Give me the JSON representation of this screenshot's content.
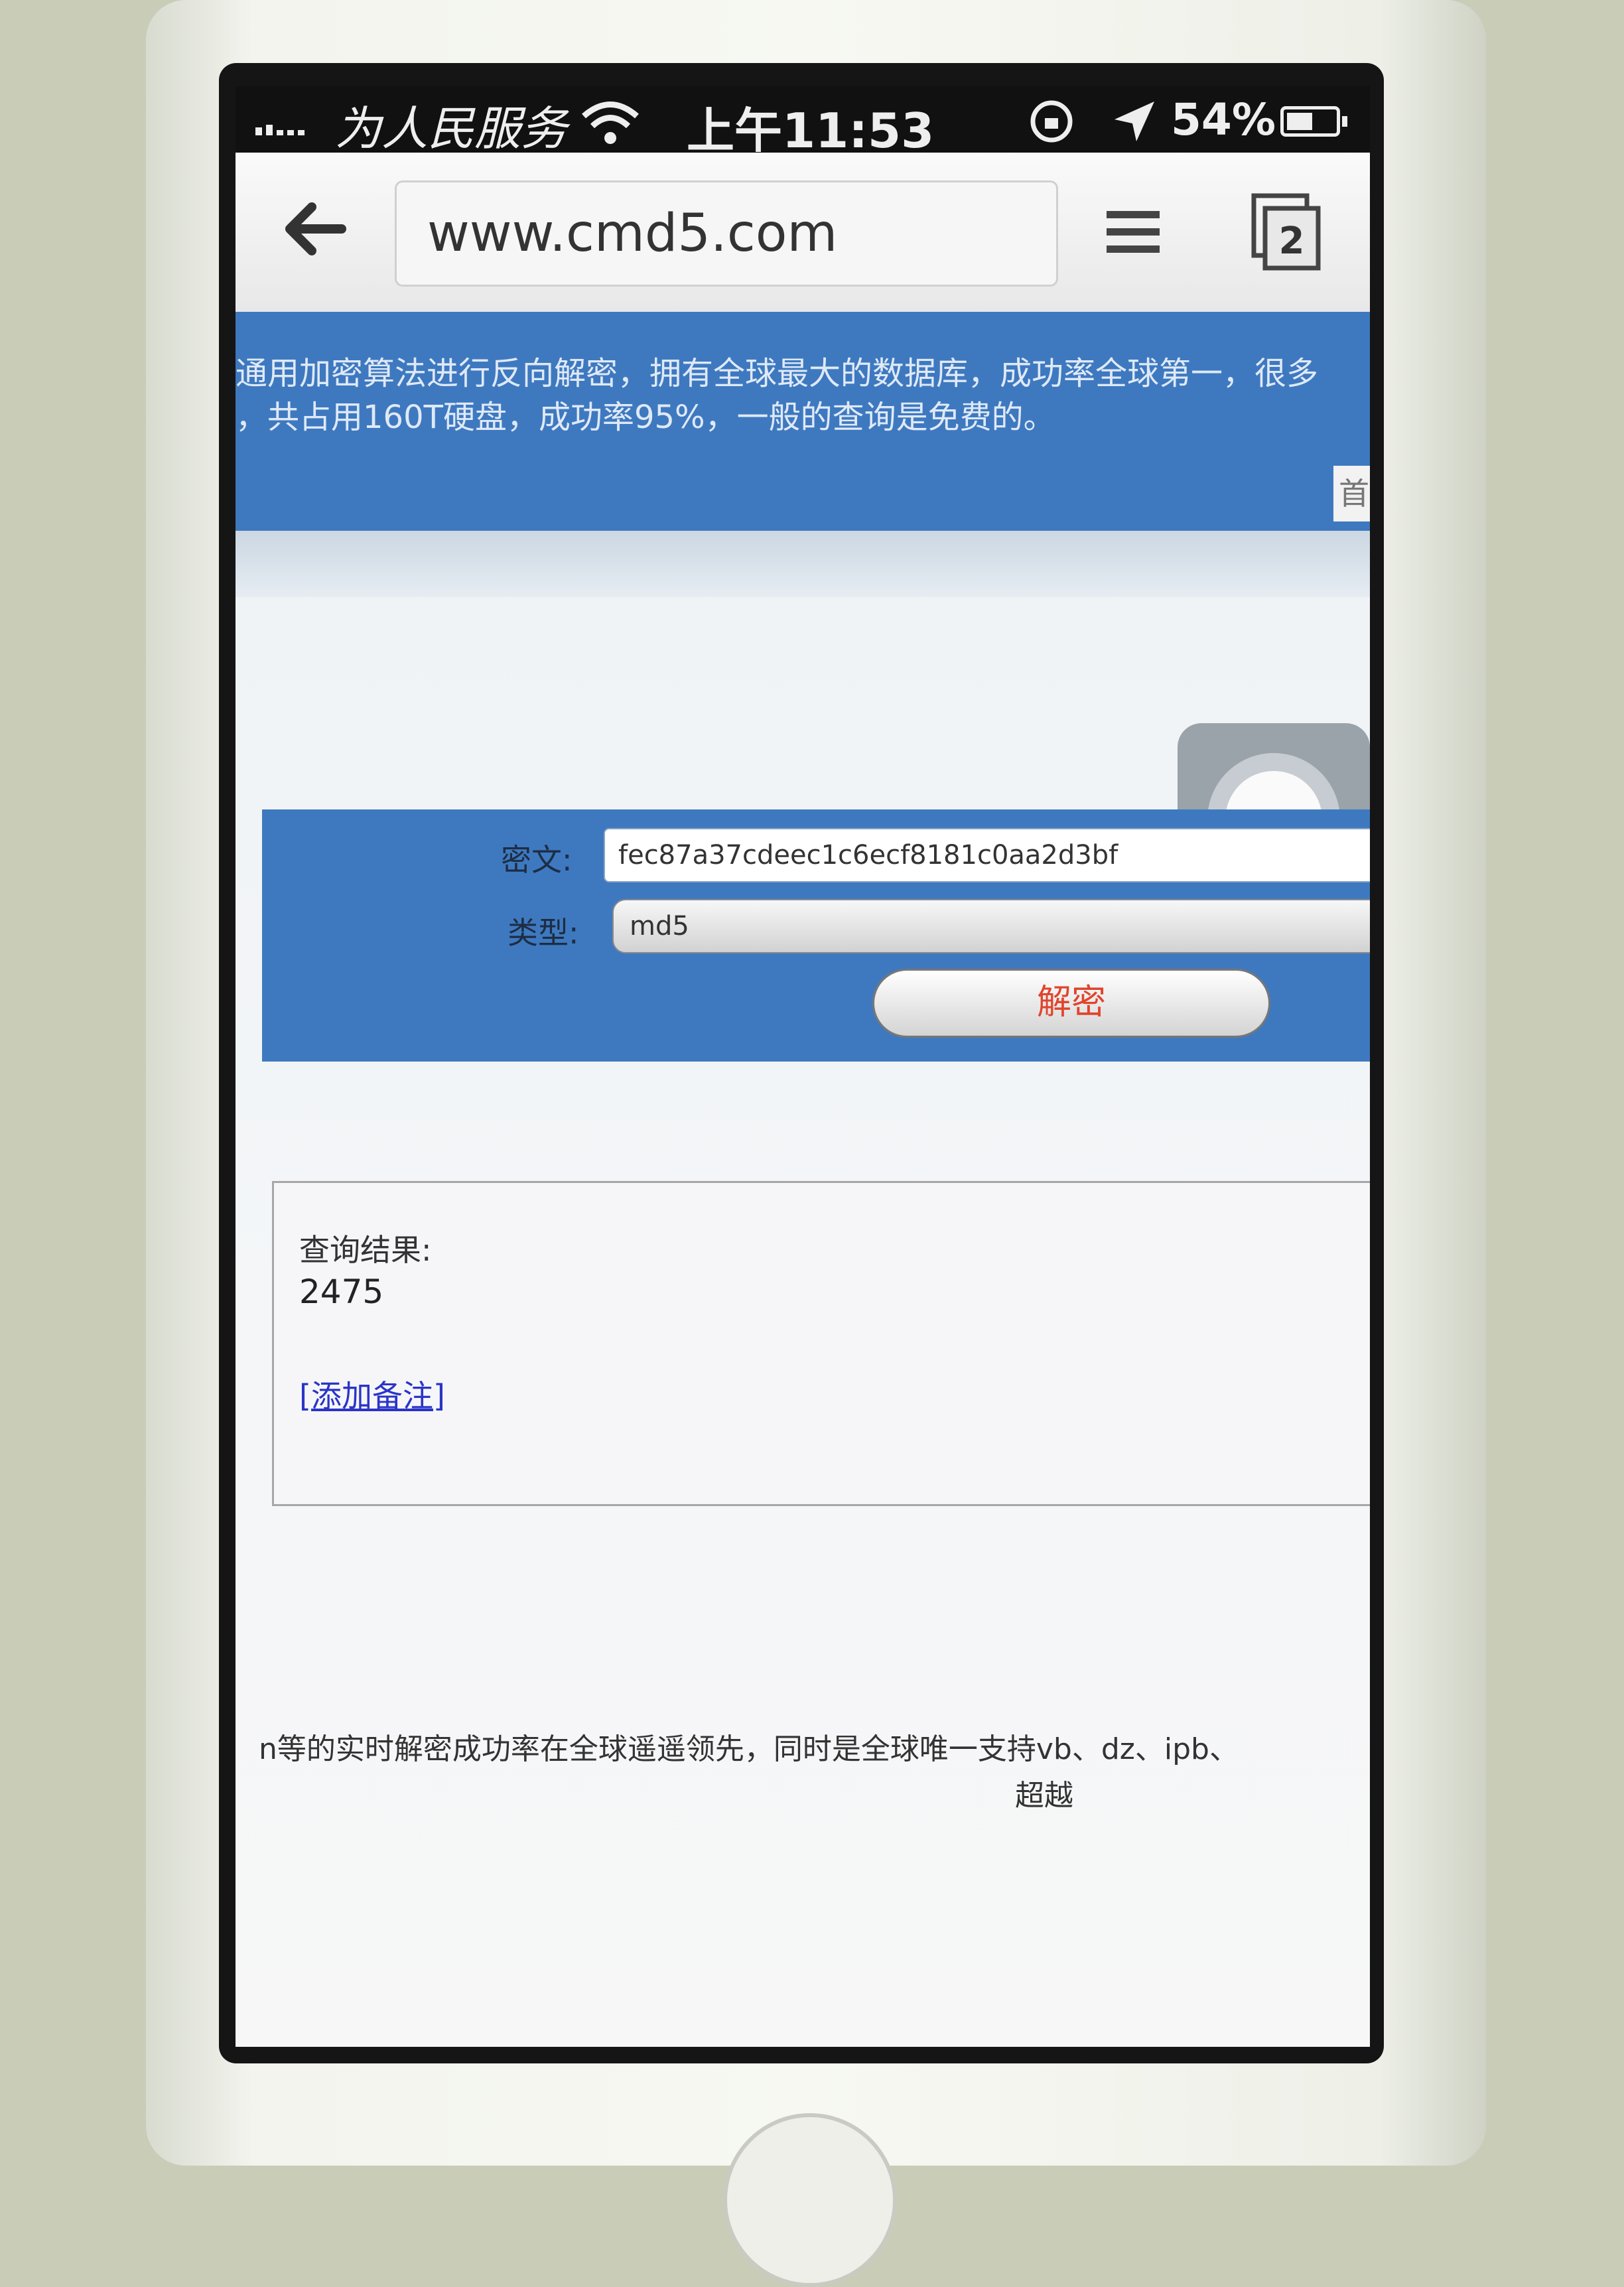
{
  "status_bar": {
    "carrier": "为人民服务",
    "time": "上午11:53",
    "battery": "54%",
    "battery_level": 0.54
  },
  "browser": {
    "url": "www.cmd5.com",
    "tab_count": "2"
  },
  "page": {
    "intro_line1": "通用加密算法进行反向解密，拥有全球最大的数据库，成功率全球第一，很多",
    "intro_line2": "，共占用160T硬盘，成功率95%，一般的查询是免费的。",
    "banner_button": "首",
    "form": {
      "cipher_label": "密文:",
      "cipher_value": "fec87a37cdeec1c6ecf8181c0aa2d3bf",
      "type_label": "类型:",
      "type_value": "md5",
      "decrypt_button": "解密"
    },
    "result": {
      "title": "查询结果:",
      "value": "2475",
      "add_note": "[添加备注]"
    },
    "footer_line1": "n等的实时解密成功率在全球遥遥领先，同时是全球唯一支持vb、dz、ipb、",
    "footer_line2": "超越"
  }
}
